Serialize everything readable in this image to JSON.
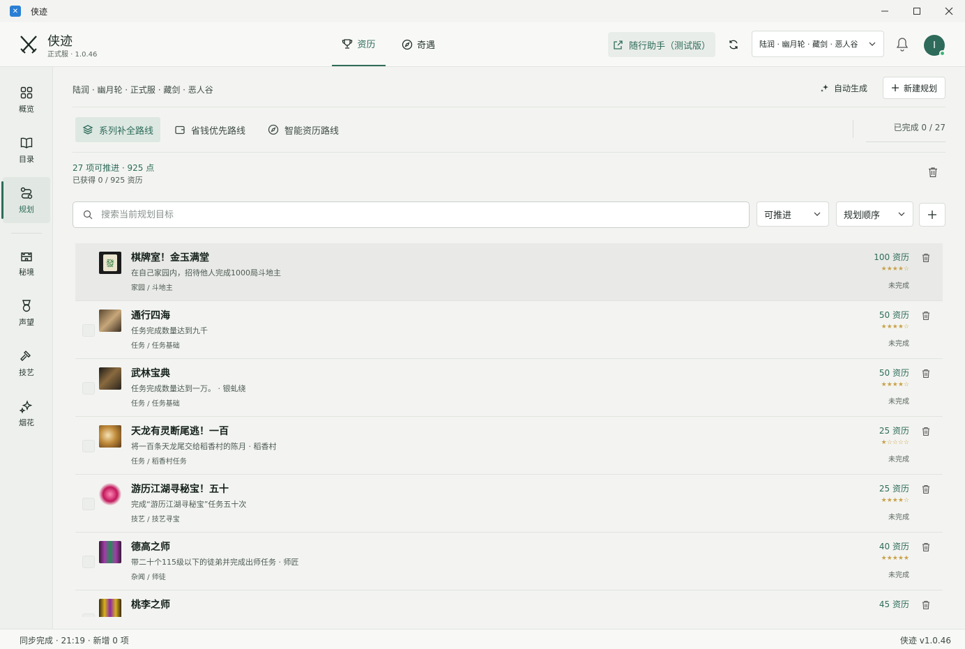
{
  "window": {
    "title": "侠迹"
  },
  "header": {
    "brand": "侠迹",
    "version": "正式服 · 1.0.46",
    "tabs": [
      {
        "label": "资历",
        "active": true
      },
      {
        "label": "奇遇",
        "active": false
      }
    ],
    "assistant": "随行助手（测试版）",
    "role": "陆润 · 幽月轮 · 藏剑 · 恶人谷",
    "avatar_initial": "I"
  },
  "sidebar": {
    "items": [
      {
        "label": "概览",
        "icon": "overview-icon"
      },
      {
        "label": "目录",
        "icon": "book-icon"
      },
      {
        "label": "规划",
        "icon": "route-icon",
        "active": true
      },
      {
        "label": "秘境",
        "icon": "castle-icon"
      },
      {
        "label": "声望",
        "icon": "medal-icon"
      },
      {
        "label": "技艺",
        "icon": "hammer-icon"
      },
      {
        "label": "烟花",
        "icon": "sparkle-icon"
      }
    ]
  },
  "main": {
    "breadcrumb": "陆润 · 幽月轮 · 正式服 · 藏剑 · 恶人谷",
    "auto_generate": "自动生成",
    "new_plan": "新建规划",
    "route_tabs": [
      "系列补全路线",
      "省钱优先路线",
      "智能资历路线"
    ],
    "completed": "已完成 0 / 27",
    "summary_main": "27 项可推进 · 925 点",
    "summary_sub": "已获得 0 / 925 资历",
    "search_placeholder": "搜索当前规划目标",
    "filter_status": "可推进",
    "filter_order": "规划顺序"
  },
  "colors": {
    "accent": "#2e6b5a",
    "star": "#c9a24a",
    "background": "#f3f4f1"
  },
  "achievements": [
    {
      "name": "棋牌室！金玉满堂",
      "desc": "在自己家园内，招待他人完成1000局斗地主",
      "category": "家园 / 斗地主",
      "points": "100 资历",
      "stars": 4,
      "state": "未完成"
    },
    {
      "name": "通行四海",
      "desc": "任务完成数量达到九千",
      "category": "任务 / 任务基础",
      "points": "50 资历",
      "stars": 4,
      "state": "未完成"
    },
    {
      "name": "武林宝典",
      "desc": "任务完成数量达到一万。 · 银虬绕",
      "category": "任务 / 任务基础",
      "points": "50 资历",
      "stars": 4,
      "state": "未完成"
    },
    {
      "name": "天龙有灵断尾逃！一百",
      "desc": "将一百条天龙尾交给稻香村的陈月 · 稻香村",
      "category": "任务 / 稻香村任务",
      "points": "25 资历",
      "stars": 1,
      "state": "未完成"
    },
    {
      "name": "游历江湖寻秘宝！五十",
      "desc": "完成“游历江湖寻秘宝”任务五十次",
      "category": "技艺 / 技艺寻宝",
      "points": "25 资历",
      "stars": 4,
      "state": "未完成"
    },
    {
      "name": "德高之师",
      "desc": "带二十个115级以下的徒弟并完成出师任务 · 师匠",
      "category": "杂闻 / 师徒",
      "points": "40 资历",
      "stars": 5,
      "state": "未完成"
    },
    {
      "name": "桃李之师",
      "desc": "",
      "category": "",
      "points": "45 资历",
      "stars": 0,
      "state": ""
    }
  ],
  "status": {
    "left": "同步完成 · 21:19 · 新增 0 项",
    "right": "侠迹 v1.0.46"
  }
}
